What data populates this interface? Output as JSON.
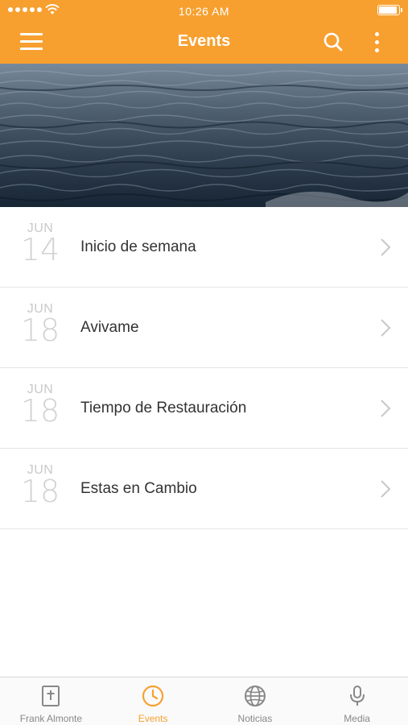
{
  "status_bar": {
    "time": "10:26 AM"
  },
  "header": {
    "title": "Events",
    "icons": [
      "menu-icon",
      "search-icon",
      "more-vertical-icon"
    ]
  },
  "hero": {
    "image": "ocean-water"
  },
  "events": [
    {
      "month": "JUN",
      "day": "14",
      "title": "Inicio de semana"
    },
    {
      "month": "JUN",
      "day": "18",
      "title": "Avivame"
    },
    {
      "month": "JUN",
      "day": "18",
      "title": "Tiempo de Restauración"
    },
    {
      "month": "JUN",
      "day": "18",
      "title": "Estas en Cambio"
    }
  ],
  "tabs": [
    {
      "label": "Frank Almonte",
      "icon": "bible-icon",
      "active": false
    },
    {
      "label": "Events",
      "icon": "clock-icon",
      "active": true
    },
    {
      "label": "Noticias",
      "icon": "globe-icon",
      "active": false
    },
    {
      "label": "Media",
      "icon": "microphone-icon",
      "active": false
    }
  ],
  "colors": {
    "accent": "#f7a030",
    "tab_inactive": "#888888",
    "date_text": "#c9c9c9"
  }
}
